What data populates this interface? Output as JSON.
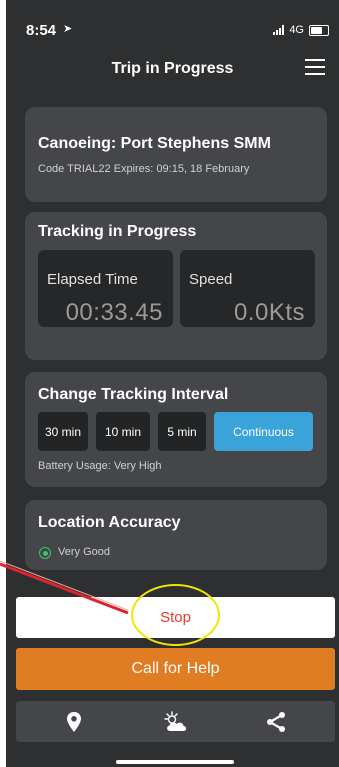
{
  "status_bar": {
    "time": "8:54",
    "network": "4G"
  },
  "nav": {
    "title": "Trip in Progress"
  },
  "trip": {
    "title": "Canoeing: Port Stephens SMM",
    "subtitle": "Code TRIAL22 Expires: 09:15, 18 February"
  },
  "tracking": {
    "title": "Tracking in Progress",
    "elapsed_label": "Elapsed Time",
    "elapsed_value": "00:33.45",
    "speed_label": "Speed",
    "speed_value": "0.0Kts"
  },
  "interval": {
    "title": "Change Tracking Interval",
    "options": [
      "30 min",
      "10 min",
      "5 min",
      "Continuous"
    ],
    "selected": "Continuous",
    "battery_text": "Battery Usage: Very High"
  },
  "accuracy": {
    "title": "Location Accuracy",
    "value": "Very Good"
  },
  "actions": {
    "stop_label": "Stop",
    "help_label": "Call for Help"
  },
  "tabs": [
    {
      "icon": "map-pin-icon"
    },
    {
      "icon": "weather-icon"
    },
    {
      "icon": "share-icon"
    }
  ],
  "colors": {
    "background": "#2e2f31",
    "card": "#44464a",
    "accent_blue": "#3aa3d9",
    "stop_red": "#e43a2f",
    "help_orange": "#e07c22",
    "annotation_yellow": "#f0e600",
    "annotation_arrow": "#d9262c",
    "accuracy_green": "#3ec46d"
  }
}
